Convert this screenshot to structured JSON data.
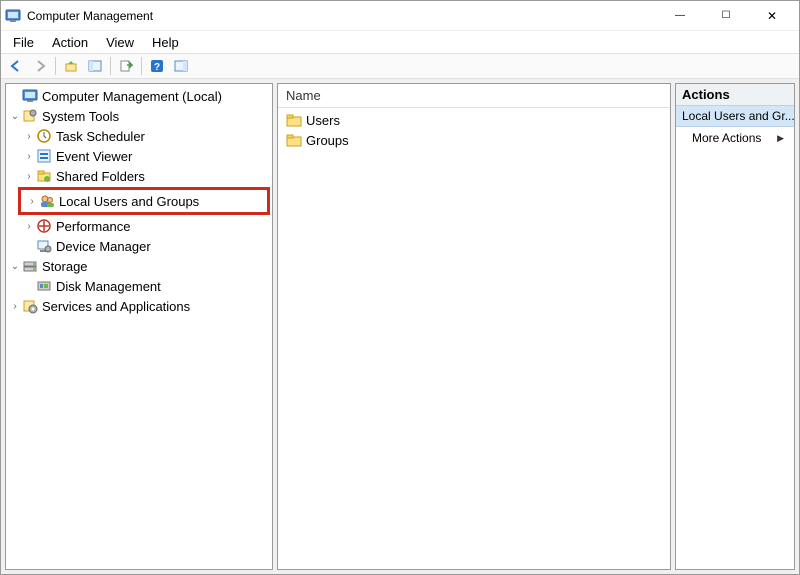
{
  "window": {
    "title": "Computer Management",
    "buttons": {
      "minimize": "—",
      "maximize": "☐",
      "close": "✕"
    }
  },
  "menubar": [
    "File",
    "Action",
    "View",
    "Help"
  ],
  "tree": {
    "root": {
      "label": "Computer Management (Local)"
    },
    "system_tools": {
      "label": "System Tools",
      "children": {
        "task_scheduler": "Task Scheduler",
        "event_viewer": "Event Viewer",
        "shared_folders": "Shared Folders",
        "local_users_groups": "Local Users and Groups",
        "performance": "Performance",
        "device_manager": "Device Manager"
      }
    },
    "storage": {
      "label": "Storage",
      "children": {
        "disk_management": "Disk Management"
      }
    },
    "services_apps": {
      "label": "Services and Applications"
    }
  },
  "list": {
    "header": "Name",
    "rows": [
      "Users",
      "Groups"
    ]
  },
  "actions": {
    "header": "Actions",
    "section": "Local Users and Gr...",
    "more": "More Actions"
  }
}
